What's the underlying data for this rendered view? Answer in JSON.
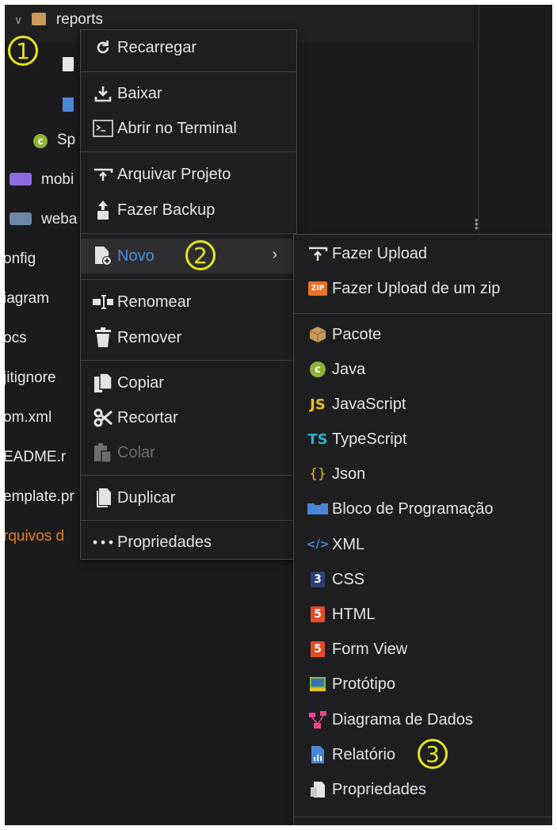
{
  "tree": {
    "root_label": "reports",
    "items": [
      "Sp",
      "mobi",
      "weba",
      "onfig",
      "iagram",
      "ocs",
      "jitignore",
      "om.xml",
      "EADME.r",
      "emplate.pr",
      "rquivos d"
    ]
  },
  "context_menu": {
    "items": [
      {
        "label": "Recarregar"
      },
      {
        "label": "Baixar"
      },
      {
        "label": "Abrir no Terminal"
      },
      {
        "label": "Arquivar Projeto"
      },
      {
        "label": "Fazer Backup"
      },
      {
        "label": "Novo"
      },
      {
        "label": "Renomear"
      },
      {
        "label": "Remover"
      },
      {
        "label": "Copiar"
      },
      {
        "label": "Recortar"
      },
      {
        "label": "Colar",
        "disabled": true
      },
      {
        "label": "Duplicar"
      },
      {
        "label": "Propriedades"
      }
    ]
  },
  "submenu": {
    "items": [
      {
        "label": "Fazer Upload"
      },
      {
        "label": "Fazer Upload de um zip"
      },
      {
        "label": "Pacote"
      },
      {
        "label": "Java"
      },
      {
        "label": "JavaScript"
      },
      {
        "label": "TypeScript"
      },
      {
        "label": "Json"
      },
      {
        "label": "Bloco de Programação"
      },
      {
        "label": "XML"
      },
      {
        "label": "CSS"
      },
      {
        "label": "HTML"
      },
      {
        "label": "Form View"
      },
      {
        "label": "Protótipo"
      },
      {
        "label": "Diagrama de Dados"
      },
      {
        "label": "Relatório"
      },
      {
        "label": "Propriedades"
      }
    ]
  },
  "markers": [
    "1",
    "2",
    "3"
  ],
  "icon_text": {
    "js": "JS",
    "ts": "TS",
    "json": "{}",
    "xml": "</>",
    "css": "3",
    "html": "5",
    "java": "c",
    "zip": "ZIP"
  },
  "colors": {
    "background": "#1b1b1d",
    "menu_bg": "#1e1e20",
    "highlight_blue": "#4e8ad8",
    "marker_yellow": "#e3e81a",
    "orange_text": "#e0802b"
  }
}
